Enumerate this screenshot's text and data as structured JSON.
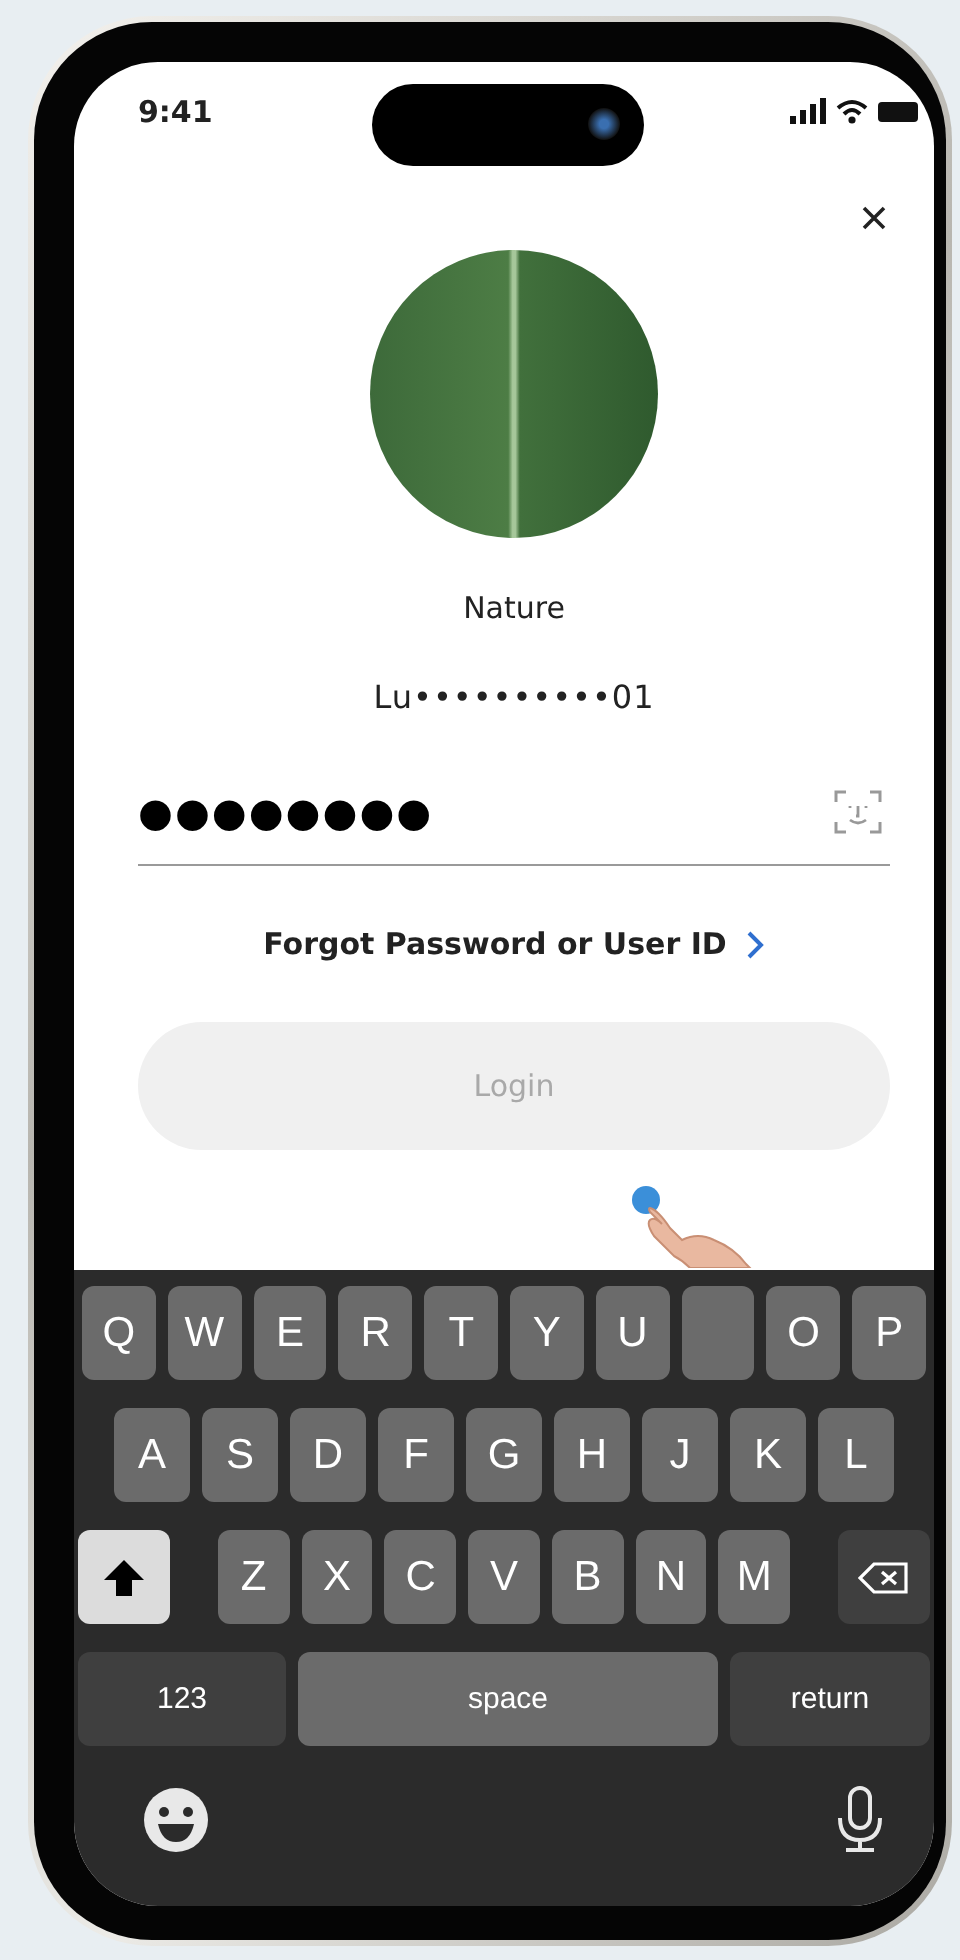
{
  "status_bar": {
    "time": "9:41"
  },
  "profile": {
    "name": "Nature",
    "user_id": "Lu••••••••••01"
  },
  "password": {
    "value": "●●●●●●●●"
  },
  "forgot_link": {
    "label": "Forgot Password or User ID"
  },
  "login_button": {
    "label": "Login",
    "disabled": true
  },
  "keyboard": {
    "letter_rows": [
      [
        {
          "kind": "letter",
          "label": "Q"
        },
        {
          "kind": "letter",
          "label": "W"
        },
        {
          "kind": "letter",
          "label": "E"
        },
        {
          "kind": "letter",
          "label": "R"
        },
        {
          "kind": "letter",
          "label": "T"
        },
        {
          "kind": "letter",
          "label": "Y"
        },
        {
          "kind": "letter",
          "label": "U"
        },
        {
          "kind": "covered"
        },
        {
          "kind": "letter",
          "label": "O"
        },
        {
          "kind": "letter",
          "label": "P"
        }
      ],
      [
        {
          "kind": "letter",
          "label": "A"
        },
        {
          "kind": "letter",
          "label": "S"
        },
        {
          "kind": "letter",
          "label": "D"
        },
        {
          "kind": "letter",
          "label": "F"
        },
        {
          "kind": "letter",
          "label": "G"
        },
        {
          "kind": "letter",
          "label": "H"
        },
        {
          "kind": "letter",
          "label": "J"
        },
        {
          "kind": "letter",
          "label": "K"
        },
        {
          "kind": "letter",
          "label": "L"
        }
      ],
      [
        {
          "kind": "shift",
          "on": true
        },
        {
          "kind": "letter",
          "label": "Z"
        },
        {
          "kind": "letter",
          "label": "X"
        },
        {
          "kind": "letter",
          "label": "C"
        },
        {
          "kind": "letter",
          "label": "V"
        },
        {
          "kind": "letter",
          "label": "B"
        },
        {
          "kind": "letter",
          "label": "N"
        },
        {
          "kind": "letter",
          "label": "M"
        },
        {
          "kind": "delete"
        }
      ]
    ],
    "numbers_key": "123",
    "space_key": "space",
    "return_key": "return"
  }
}
